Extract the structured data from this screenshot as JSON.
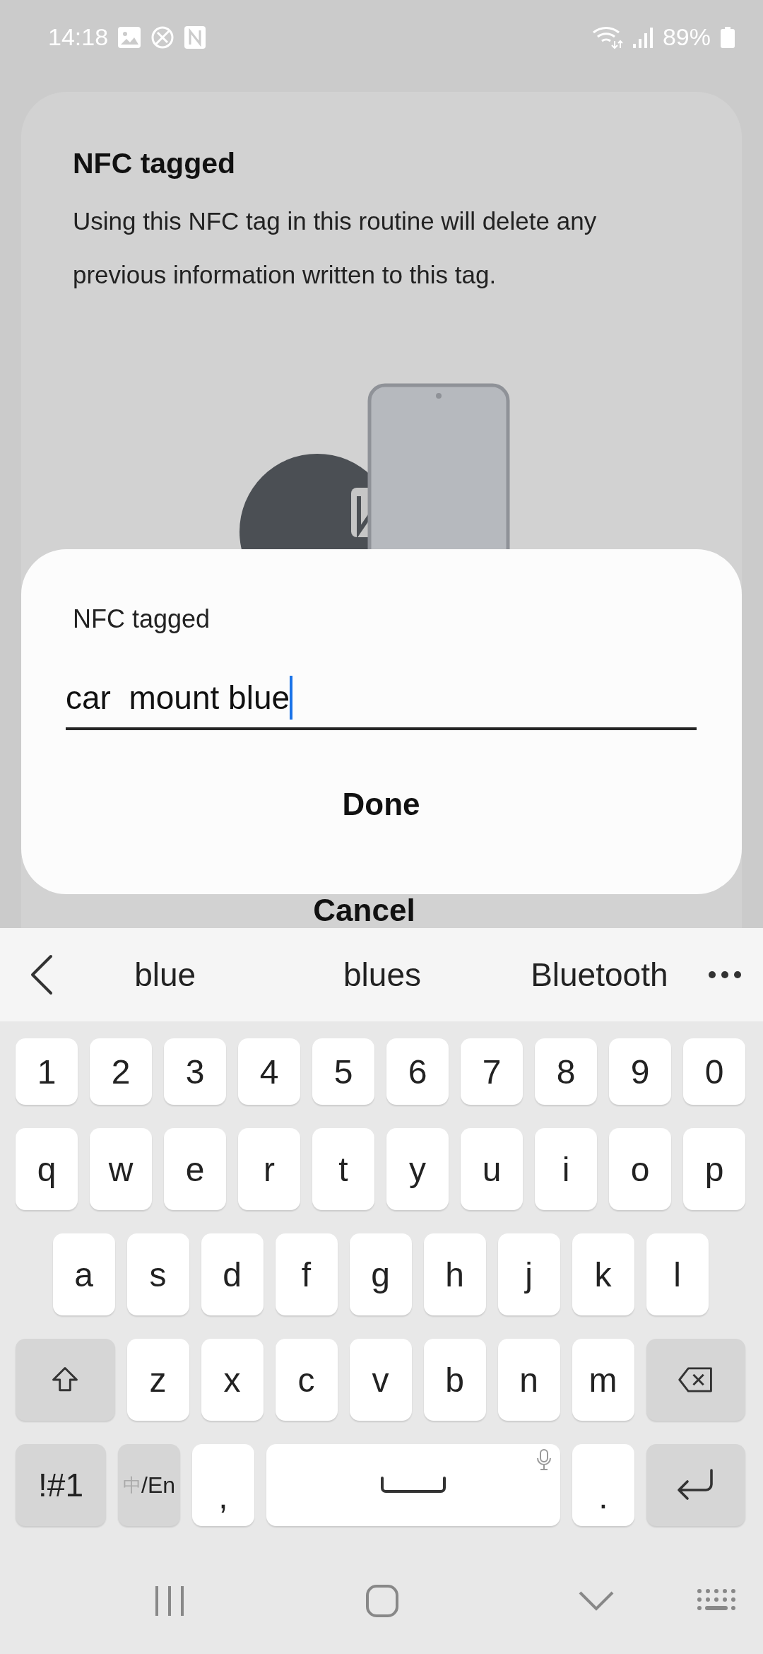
{
  "status_bar": {
    "time": "14:18",
    "battery": "89%"
  },
  "background_card": {
    "title": "NFC tagged",
    "description": "Using this NFC tag in this routine will delete any previous information written to this tag.",
    "cancel": "Cancel"
  },
  "dialog": {
    "label": "NFC tagged",
    "value": "car  mount blue",
    "done": "Done"
  },
  "suggestions": [
    "blue",
    "blues",
    "Bluetooth"
  ],
  "keyboard": {
    "rows": [
      [
        {
          "kind": "char",
          "label": "1"
        },
        {
          "kind": "char",
          "label": "2"
        },
        {
          "kind": "char",
          "label": "3"
        },
        {
          "kind": "char",
          "label": "4"
        },
        {
          "kind": "char",
          "label": "5"
        },
        {
          "kind": "char",
          "label": "6"
        },
        {
          "kind": "char",
          "label": "7"
        },
        {
          "kind": "char",
          "label": "8"
        },
        {
          "kind": "char",
          "label": "9"
        },
        {
          "kind": "char",
          "label": "0"
        }
      ],
      [
        {
          "kind": "char",
          "label": "q"
        },
        {
          "kind": "char",
          "label": "w"
        },
        {
          "kind": "char",
          "label": "e"
        },
        {
          "kind": "char",
          "label": "r"
        },
        {
          "kind": "char",
          "label": "t"
        },
        {
          "kind": "char",
          "label": "y"
        },
        {
          "kind": "char",
          "label": "u"
        },
        {
          "kind": "char",
          "label": "i"
        },
        {
          "kind": "char",
          "label": "o"
        },
        {
          "kind": "char",
          "label": "p"
        }
      ],
      [
        {
          "kind": "char",
          "label": "a"
        },
        {
          "kind": "char",
          "label": "s"
        },
        {
          "kind": "char",
          "label": "d"
        },
        {
          "kind": "char",
          "label": "f"
        },
        {
          "kind": "char",
          "label": "g"
        },
        {
          "kind": "char",
          "label": "h"
        },
        {
          "kind": "char",
          "label": "j"
        },
        {
          "kind": "char",
          "label": "k"
        },
        {
          "kind": "char",
          "label": "l"
        }
      ],
      [
        {
          "kind": "shift"
        },
        {
          "kind": "char",
          "label": "z"
        },
        {
          "kind": "char",
          "label": "x"
        },
        {
          "kind": "char",
          "label": "c"
        },
        {
          "kind": "char",
          "label": "v"
        },
        {
          "kind": "char",
          "label": "b"
        },
        {
          "kind": "char",
          "label": "n"
        },
        {
          "kind": "char",
          "label": "m"
        },
        {
          "kind": "backspace"
        }
      ],
      [
        {
          "kind": "symbols",
          "label": "!#1"
        },
        {
          "kind": "lang",
          "dim": "中",
          "label": "/En"
        },
        {
          "kind": "char",
          "label": ","
        },
        {
          "kind": "space"
        },
        {
          "kind": "char",
          "label": "."
        },
        {
          "kind": "enter"
        }
      ]
    ]
  }
}
